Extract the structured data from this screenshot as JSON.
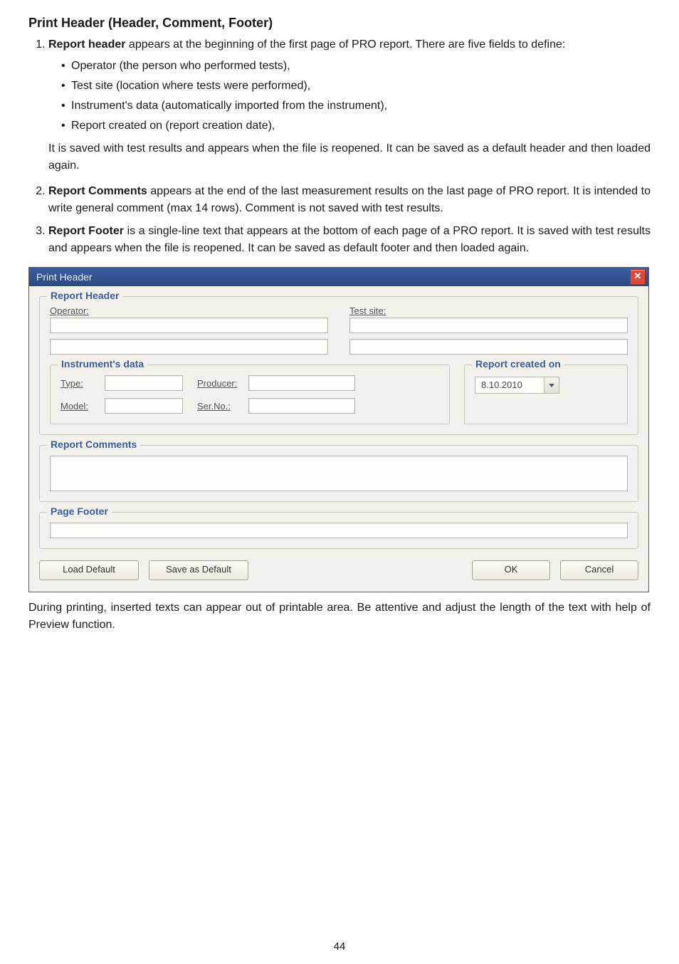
{
  "page_number": "44",
  "doc": {
    "section_title": "Print Header (Header, Comment, Footer)",
    "items": [
      {
        "lead": "Report header",
        "tail": " appears at the beginning of the first page of PRO report. There are five fields to define:",
        "bullets": [
          "Operator (the person who performed tests),",
          "Test site (location where tests were performed),",
          "Instrument's data (automatically imported from the instrument),",
          "Report created on (report creation date),"
        ],
        "after": "It is saved with test results and appears when the file is reopened. It can be saved as a default header and then loaded again."
      },
      {
        "lead": "Report Comments",
        "tail": " appears at the end of the last measurement results on the last page of PRO report. It is intended to write general comment (max 14 rows). Comment is not saved with test results."
      },
      {
        "lead": "Report Footer",
        "tail": " is a single-line text that appears at the bottom of each page of a PRO report. It is saved with test results and appears when the file is reopened. It can be saved as default footer and then loaded again."
      }
    ],
    "closing_note": "During printing, inserted texts can appear out of printable area. Be attentive and adjust the length of the text with help of Preview function."
  },
  "dialog": {
    "title": "Print Header",
    "close_glyph": "✕",
    "groups": {
      "report_header": {
        "legend": "Report Header",
        "operator_label": "Operator:",
        "test_site_label": "Test site:",
        "instrument_data": {
          "legend": "Instrument's data",
          "type_label": "Type:",
          "model_label": "Model:",
          "producer_label": "Producer:",
          "serno_label": "Ser.No.:"
        },
        "report_created": {
          "legend": "Report created on",
          "date_value": "8.10.2010"
        }
      },
      "report_comments": {
        "legend": "Report Comments"
      },
      "page_footer": {
        "legend": "Page Footer"
      }
    },
    "buttons": {
      "load_default": "Load Default",
      "save_default": "Save as Default",
      "ok": "OK",
      "cancel": "Cancel"
    }
  }
}
